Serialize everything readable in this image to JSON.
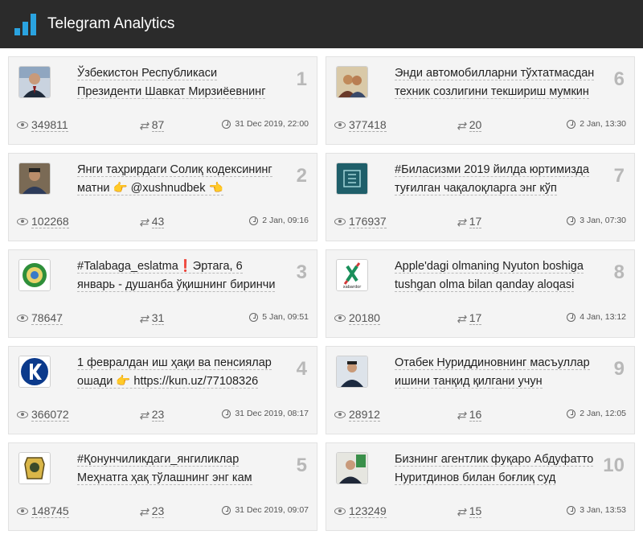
{
  "app": {
    "title": "Telegram Analytics"
  },
  "posts": [
    {
      "rank": "1",
      "line1": "Ўзбекистон Республикаси",
      "line2": "Президенти Шавкат Мирзиёевнинг",
      "views": "349811",
      "reposts": "87",
      "date": "31 Dec 2019, 22:00",
      "thumb": "president-photo"
    },
    {
      "rank": "2",
      "line1": "Янги таҳрирдаги Солиқ кодексининг",
      "line2": "матни 👉 @xushnudbek 👈",
      "views": "102268",
      "reposts": "43",
      "date": "2 Jan, 09:16",
      "thumb": "man-photo"
    },
    {
      "rank": "3",
      "line1": "#Talabaga_eslatma❗Эртага, 6",
      "line2": "январь - душанба ўқишнинг биринчи",
      "views": "78647",
      "reposts": "31",
      "date": "5 Jan, 09:51",
      "thumb": "emblem-logo"
    },
    {
      "rank": "4",
      "line1": "1 февралдан иш ҳақи ва пенсиялар",
      "line2": "ошади 👉 https://kun.uz/77108326",
      "views": "366072",
      "reposts": "23",
      "date": "31 Dec 2019, 08:17",
      "thumb": "kun-k-logo"
    },
    {
      "rank": "5",
      "line1": "#Қонунчиликдаги_янгиликлар",
      "line2": "Меҳнатга ҳақ тўлашнинг энг кам",
      "views": "148745",
      "reposts": "23",
      "date": "31 Dec 2019, 09:07",
      "thumb": "justice-logo"
    },
    {
      "rank": "6",
      "line1": "Энди автомобилларни тўхтатмасдан",
      "line2": "техник созлигини текшириш мумкин",
      "views": "377418",
      "reposts": "20",
      "date": "2 Jan, 13:30",
      "thumb": "people-photo"
    },
    {
      "rank": "7",
      "line1": "#Биласизми 2019 йилда юртимизда",
      "line2": "туғилган чақалоқларга энг кўп",
      "views": "176937",
      "reposts": "17",
      "date": "3 Jan, 07:30",
      "thumb": "teal-logo"
    },
    {
      "rank": "8",
      "line1": "Apple'dagi olmaning Nyuton boshiga",
      "line2": "tushgan olma bilan qanday aloqasi",
      "views": "20180",
      "reposts": "17",
      "date": "4 Jan, 13:12",
      "thumb": "xabardor-logo"
    },
    {
      "rank": "9",
      "line1": "Отабек Нуриддиновнинг масъуллар",
      "line2": "ишини танқид қилгани учун",
      "views": "28912",
      "reposts": "16",
      "date": "2 Jan, 12:05",
      "thumb": "official-photo"
    },
    {
      "rank": "10",
      "line1": "Бизнинг агентлик фуқаро Абдуфатто",
      "line2": "Нуритдинов билан боғлиқ суд",
      "views": "123249",
      "reposts": "15",
      "date": "3 Jan, 13:53",
      "thumb": "man-suit-photo"
    }
  ],
  "xabardor_text": "xabardor"
}
